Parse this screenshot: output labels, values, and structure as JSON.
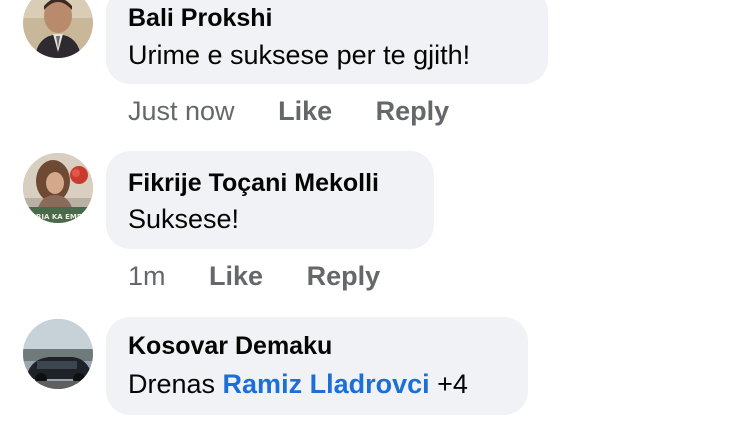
{
  "comments": [
    {
      "author": "Bali Prokshi",
      "text": "Urime e suksese per te gjith!",
      "time": "Just now",
      "like_label": "Like",
      "reply_label": "Reply"
    },
    {
      "author": "Fikrije Toçani Mekolli",
      "text": "Suksese!",
      "time": "1m",
      "like_label": "Like",
      "reply_label": "Reply",
      "avatar_caption": "LIRIA KA EMER"
    },
    {
      "author": "Kosovar Demaku",
      "text_prefix": "Drenas ",
      "mention": "Ramiz Lladrovci",
      "text_suffix": " +4"
    }
  ],
  "colors": {
    "bubble": "#f0f2f5",
    "meta_text": "#65676b",
    "mention": "#1b6fd6"
  }
}
